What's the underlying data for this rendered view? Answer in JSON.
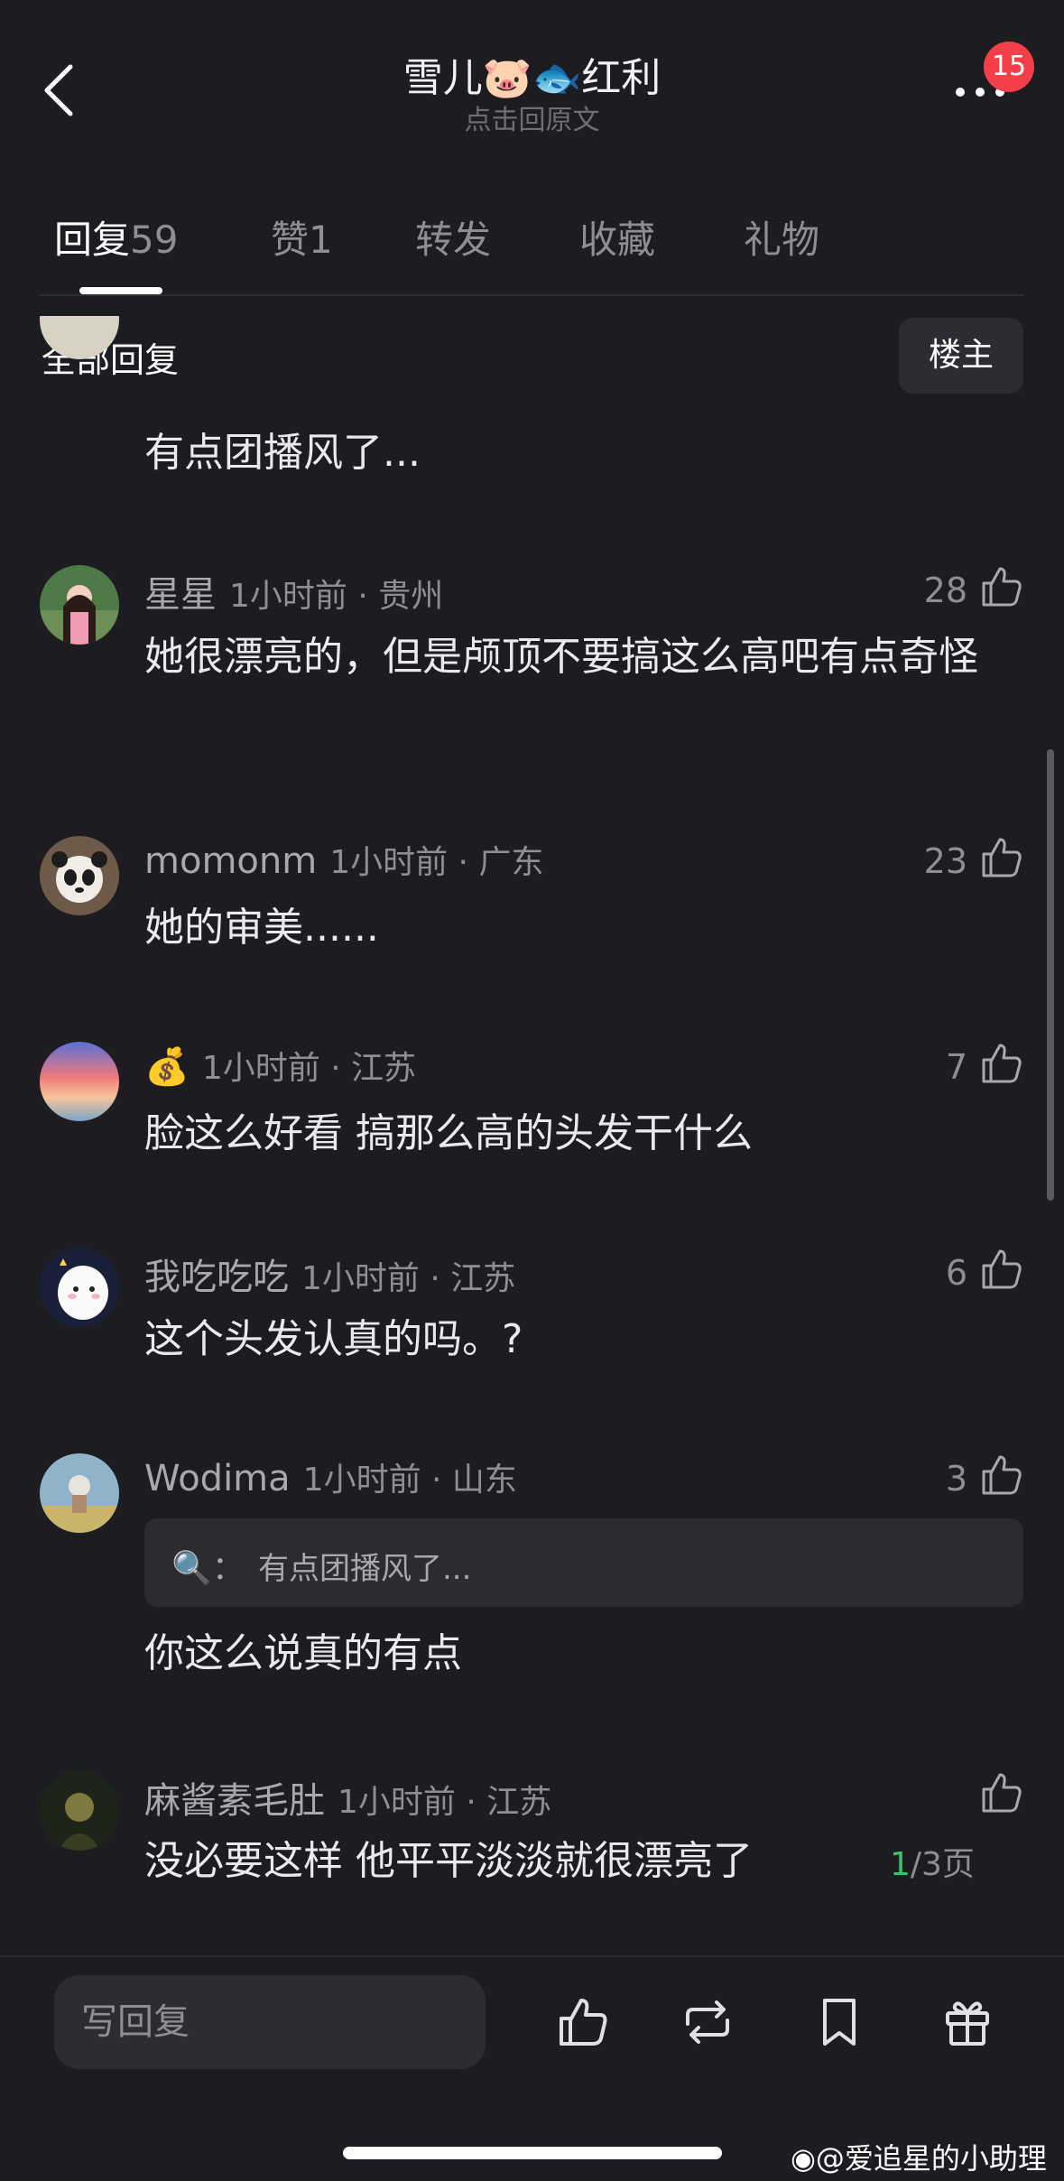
{
  "header": {
    "title": "雪儿🐷🐟红利",
    "subtitle": "点击回原文",
    "notification_count": "15"
  },
  "tabs": [
    {
      "label": "回复",
      "count": "59"
    },
    {
      "label": "赞",
      "count": "1"
    },
    {
      "label": "转发"
    },
    {
      "label": "收藏"
    },
    {
      "label": "礼物"
    }
  ],
  "filter": {
    "all_replies": "全部回复",
    "op_only": "楼主"
  },
  "comments": [
    {
      "text": "有点团播风了..."
    },
    {
      "user": "星星",
      "meta": "1小时前 · 贵州",
      "likes": "28",
      "text": "她很漂亮的，但是颅顶不要搞这么高吧有点奇怪"
    },
    {
      "user": "momonm",
      "meta": "1小时前 · 广东",
      "likes": "23",
      "text": "她的审美......"
    },
    {
      "user": "💰",
      "meta": "1小时前 · 江苏",
      "likes": "7",
      "text": "脸这么好看 搞那么高的头发干什么"
    },
    {
      "user": "我吃吃吃",
      "meta": "1小时前 · 江苏",
      "likes": "6",
      "text": "这个头发认真的吗。?"
    },
    {
      "user": "Wodima",
      "meta": "1小时前 · 山东",
      "likes": "3",
      "quote_user": "🔍：",
      "quote": "有点团播风了...",
      "text": "你这么说真的有点"
    },
    {
      "user": "麻酱素毛肚",
      "meta": "1小时前 · 江苏",
      "likes": "",
      "text": "没必要这样  他平平淡淡就很漂亮了"
    }
  ],
  "pager": {
    "current": "1",
    "total": "/3页"
  },
  "bottom": {
    "reply_placeholder": "写回复"
  },
  "watermark": "@爱追星的小助理",
  "colors": {
    "background": "#1d1d21",
    "badge": "#f43f4a",
    "pager_current": "#39c36a"
  }
}
